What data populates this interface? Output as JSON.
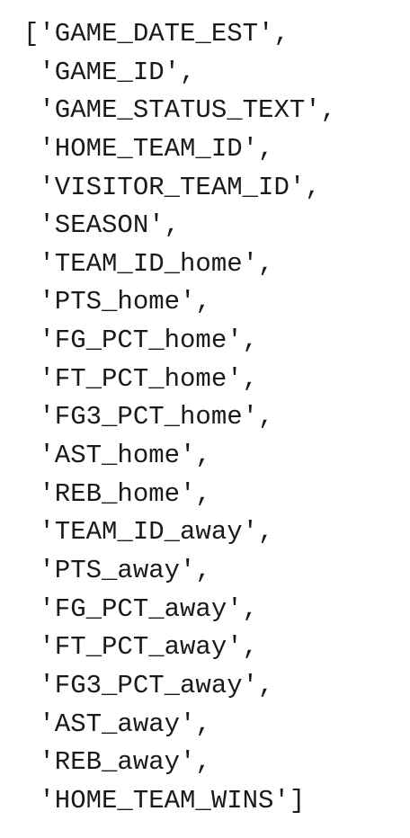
{
  "output": {
    "lines": [
      "['GAME_DATE_EST',",
      " 'GAME_ID',",
      " 'GAME_STATUS_TEXT',",
      " 'HOME_TEAM_ID',",
      " 'VISITOR_TEAM_ID',",
      " 'SEASON',",
      " 'TEAM_ID_home',",
      " 'PTS_home',",
      " 'FG_PCT_home',",
      " 'FT_PCT_home',",
      " 'FG3_PCT_home',",
      " 'AST_home',",
      " 'REB_home',",
      " 'TEAM_ID_away',",
      " 'PTS_away',",
      " 'FG_PCT_away',",
      " 'FT_PCT_away',",
      " 'FG3_PCT_away',",
      " 'AST_away',",
      " 'REB_away',",
      " 'HOME_TEAM_WINS']"
    ]
  }
}
